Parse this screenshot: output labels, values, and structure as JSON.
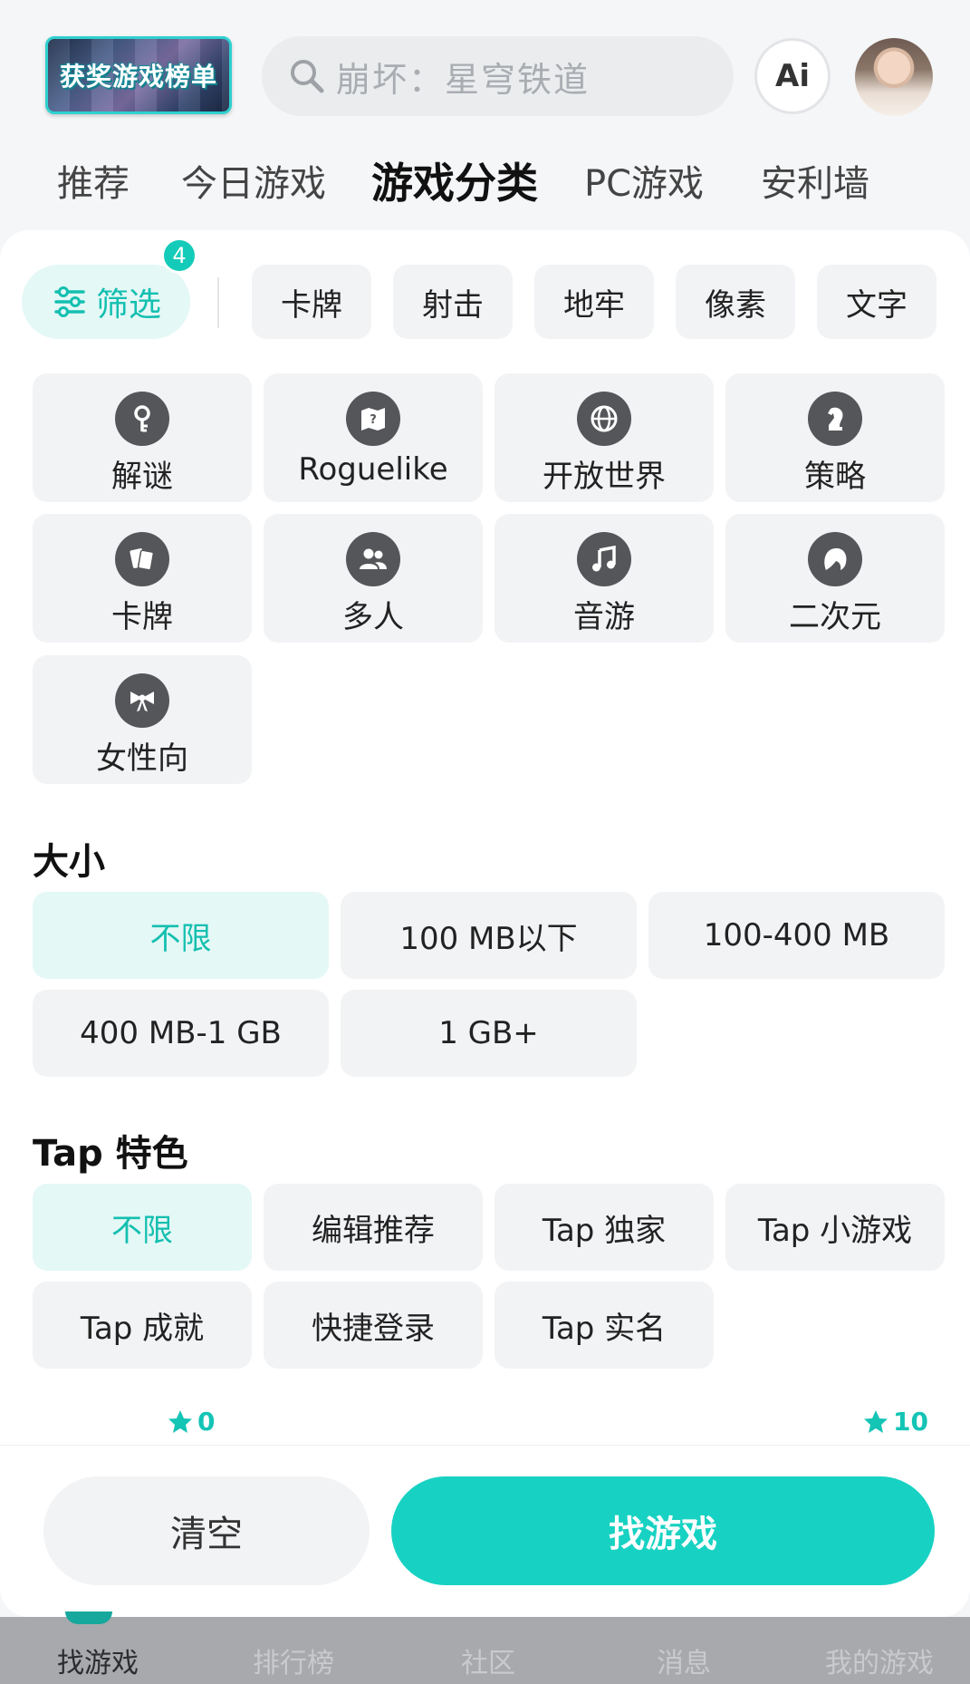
{
  "header": {
    "logo_text": "获奖游戏榜单",
    "search_placeholder": "崩坏：星穹铁道",
    "ai_label": "Ai"
  },
  "tabs": [
    {
      "label": "推荐"
    },
    {
      "label": "今日游戏"
    },
    {
      "label": "游戏分类",
      "active": true
    },
    {
      "label": "PC游戏"
    },
    {
      "label": "安利墙"
    }
  ],
  "filter": {
    "label": "筛选",
    "badge": "4",
    "chips": [
      "卡牌",
      "射击",
      "地牢",
      "像素",
      "文字"
    ]
  },
  "categories": [
    {
      "label": "解谜",
      "icon": "key-icon"
    },
    {
      "label": "Roguelike",
      "icon": "map-icon"
    },
    {
      "label": "开放世界",
      "icon": "globe-icon"
    },
    {
      "label": "策略",
      "icon": "chess-knight-icon"
    },
    {
      "label": "卡牌",
      "icon": "cards-icon"
    },
    {
      "label": "多人",
      "icon": "people-icon"
    },
    {
      "label": "音游",
      "icon": "music-note-icon"
    },
    {
      "label": "二次元",
      "icon": "anime-head-icon"
    },
    {
      "label": "女性向",
      "icon": "bow-icon"
    }
  ],
  "size_section": {
    "title": "大小",
    "options": [
      {
        "label": "不限",
        "active": true
      },
      {
        "label": "100 MB以下"
      },
      {
        "label": "100-400 MB"
      },
      {
        "label": "400 MB-1 GB"
      },
      {
        "label": "1 GB+"
      }
    ]
  },
  "tap_section": {
    "title": "Tap 特色",
    "options": [
      {
        "label": "不限",
        "active": true
      },
      {
        "label": "编辑推荐"
      },
      {
        "label": "Tap 独家"
      },
      {
        "label": "Tap 小游戏"
      },
      {
        "label": "Tap 成就"
      },
      {
        "label": "快捷登录"
      },
      {
        "label": "Tap 实名"
      }
    ]
  },
  "rating": {
    "min": "0",
    "max": "10"
  },
  "footer": {
    "clear_label": "清空",
    "find_label": "找游戏"
  },
  "bottom_nav": [
    {
      "label": "找游戏",
      "active": true
    },
    {
      "label": "排行榜"
    },
    {
      "label": "社区"
    },
    {
      "label": "消息"
    },
    {
      "label": "我的游戏"
    }
  ],
  "colors": {
    "accent": "#17d2c2",
    "accent_light": "#e4f8f6",
    "chip_bg": "#f2f3f5"
  }
}
